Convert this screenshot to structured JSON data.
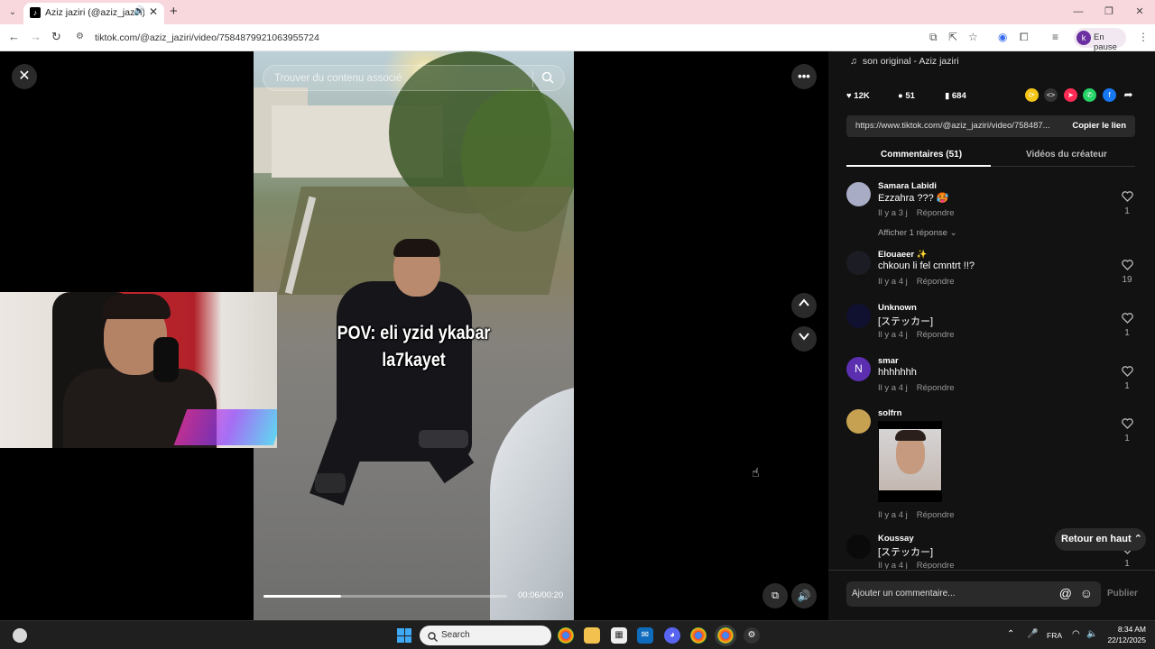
{
  "browser": {
    "tab_title": "Aziz jaziri (@aziz_jaziri) | Tik",
    "url": "tiktok.com/@aziz_jaziri/video/7584879921063955724",
    "profile_status": "En pause",
    "profile_initial": "k"
  },
  "video": {
    "search_placeholder": "Trouver du contenu associé",
    "caption_line1": "POV: eli yzid ykabar",
    "caption_line2": "la7kayet",
    "time": "00:06/00:20",
    "progress": 0.32
  },
  "panel": {
    "music": "son original - Aziz jaziri",
    "likes": "12K",
    "comments_count": "51",
    "saves": "684",
    "share_link": "https://www.tiktok.com/@aziz_jaziri/video/758487...",
    "copy_link": "Copier le lien",
    "tab_comments": "Commentaires (51)",
    "tab_creator": "Vidéos du créateur",
    "reply_label": "Répondre",
    "view_replies": "Afficher 1 réponse",
    "back_to_top": "Retour en haut",
    "comment_placeholder": "Ajouter un commentaire...",
    "publish": "Publier"
  },
  "comments": [
    {
      "user": "Samara Labidi",
      "text": "Ezzahra ??? 🥵",
      "time": "Il y a 3 j",
      "likes": "1"
    },
    {
      "user": "Elouaeer ✨",
      "text": "chkoun li fel cmntrt !!?",
      "time": "Il y a 4 j",
      "likes": "19"
    },
    {
      "user": "Unknown",
      "text": "[ステッカー]",
      "time": "Il y a 4 j",
      "likes": "1"
    },
    {
      "user": "smar",
      "text": "hhhhhhh",
      "time": "Il y a 4 j",
      "likes": "1",
      "initial": "N"
    },
    {
      "user": "solfrn",
      "text": "",
      "time": "Il y a 4 j",
      "likes": "1"
    },
    {
      "user": "Koussay",
      "text": "[ステッカー]",
      "time": "Il y a 4 j",
      "likes": "1"
    }
  ],
  "taskbar": {
    "search": "Search",
    "lang": "FRA",
    "time": "8:34 AM",
    "date": "22/12/2025"
  },
  "colors": {
    "panel_bg": "#121212",
    "accent_red": "#fe2c55",
    "tab_bar": "#f8d7dd"
  }
}
